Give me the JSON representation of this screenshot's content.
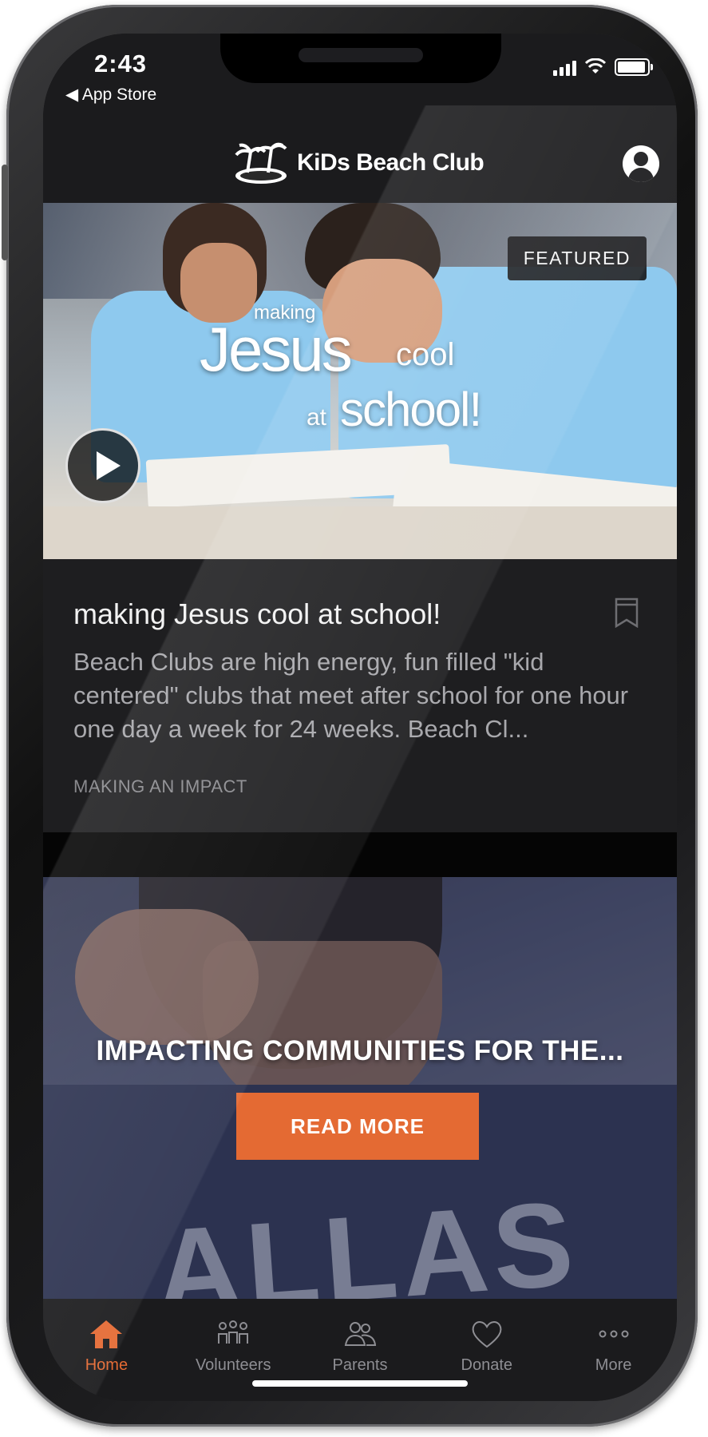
{
  "status_bar": {
    "time": "2:43",
    "back_app": "◀ App Store"
  },
  "header": {
    "brand": "KiDs Beach Club"
  },
  "featured": {
    "badge": "FEATURED",
    "overlay": {
      "making": "making",
      "jesus": "Jesus",
      "cool": "cool",
      "at": "at",
      "school": "school!"
    },
    "title": "making Jesus cool at school!",
    "description": "Beach Clubs are high energy, fun filled \"kid centered\" clubs that meet after school for one hour one day a week for 24 weeks. Beach Cl...",
    "category": "MAKING AN IMPACT"
  },
  "promo": {
    "title": "IMPACTING COMMUNITIES FOR THE...",
    "button_label": "READ MORE",
    "shirt_text": "ALLAS"
  },
  "tabs": [
    {
      "label": "Home",
      "icon": "home-icon",
      "active": true
    },
    {
      "label": "Volunteers",
      "icon": "volunteers-icon",
      "active": false
    },
    {
      "label": "Parents",
      "icon": "parents-icon",
      "active": false
    },
    {
      "label": "Donate",
      "icon": "heart-icon",
      "active": false
    },
    {
      "label": "More",
      "icon": "more-dots-icon",
      "active": false
    }
  ],
  "colors": {
    "accent": "#e46a33",
    "background": "#1b1b1d",
    "card": "#1e1e20"
  }
}
